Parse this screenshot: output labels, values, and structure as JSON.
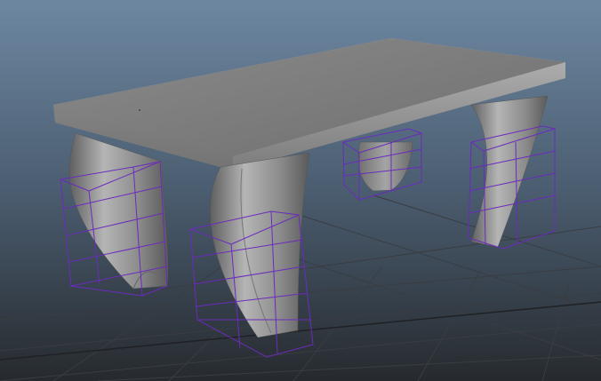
{
  "viewport": {
    "view_type": "perspective",
    "background": {
      "top": "#6d87a1",
      "mid": "#4b5d70",
      "bottom": "#262a2e"
    },
    "grid_color": "#3a3d42",
    "grid_axis_color": "#1f2124"
  },
  "scene": {
    "object": "table",
    "surface_color": "#8e8e8e",
    "lattice_color": "#6b2bbd",
    "lattice_count": 4
  }
}
